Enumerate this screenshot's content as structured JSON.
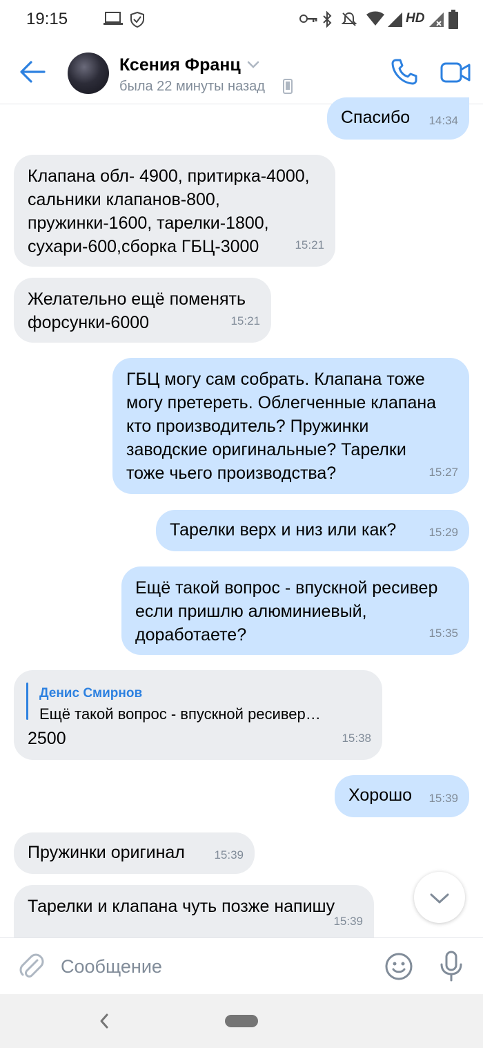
{
  "status_bar": {
    "time": "19:15",
    "network_type": "HD"
  },
  "header": {
    "contact_name": "Ксения Франц",
    "last_seen": "была 22 минуты назад"
  },
  "messages": [
    {
      "direction": "out",
      "text": "Спасибо",
      "time": "14:34"
    },
    {
      "direction": "in",
      "text": "Клапана обл- 4900, притирка-4000,\nсальники клапанов-800,\nпружинки-1600, тарелки-1800,\nсухари-600,сборка ГБЦ-3000",
      "time": "15:21"
    },
    {
      "direction": "in",
      "text": "Желательно ещё поменять\nфорсунки-6000",
      "time": "15:21"
    },
    {
      "direction": "out",
      "text": "ГБЦ могу сам собрать. Клапана тоже\nмогу претереть. Облегченные клапана\nкто производитель? Пружинки\nзаводские оригинальные? Тарелки\nтоже чьего производства?",
      "time": "15:27"
    },
    {
      "direction": "out",
      "text": "Тарелки верх и низ или как?",
      "time": "15:29"
    },
    {
      "direction": "out",
      "text": "Ещё такой вопрос - впускной ресивер\nесли пришлю алюминиевый,\nдоработаете?",
      "time": "15:35"
    },
    {
      "direction": "in",
      "reply_author": "Денис Смирнов",
      "reply_text": "Ещё такой вопрос - впускной ресивер…",
      "text": "2500",
      "time": "15:38"
    },
    {
      "direction": "out",
      "text": "Хорошо",
      "time": "15:39"
    },
    {
      "direction": "in",
      "text": "Пружинки оригинал",
      "time": "15:39"
    },
    {
      "direction": "in",
      "text": "Тарелки и клапана чуть позже напишу",
      "time": "15:39"
    }
  ],
  "composer": {
    "placeholder": "Сообщение"
  },
  "colors": {
    "accent": "#2d81e0",
    "incoming_bubble": "#ebedf0",
    "outgoing_bubble": "#cce4ff",
    "secondary_text": "#818c99"
  }
}
